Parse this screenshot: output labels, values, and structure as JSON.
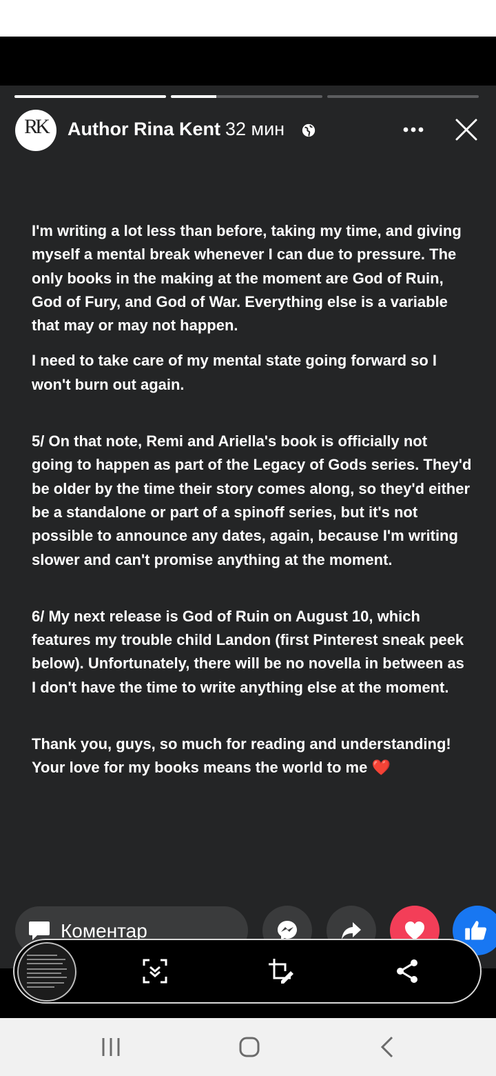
{
  "story": {
    "progress": [
      1.0,
      0.3,
      0.0
    ],
    "author_name": "Author Rina Kent",
    "avatar_monogram": "RK",
    "time": "32 мин",
    "privacy_icon": "globe-icon",
    "more_icon": "more-icon",
    "close_icon": "close-icon"
  },
  "post": {
    "paragraphs": [
      "I'm writing a lot less than before, taking my time, and giving myself a mental break whenever I can due to pressure. The only books in the making at the moment are God of Ruin, God of Fury, and God of War. Everything else is a variable that may or may not happen.",
      "I need to take care of my mental state going forward so I won't burn out again.",
      "5/ On that note, Remi and Ariella's book is officially not going to happen as part of the Legacy of Gods series. They'd be older by the time their story comes along, so they'd either be a standalone or part of a spinoff series, but it's not possible to announce any dates, again, because I'm writing slower and can't promise anything at the moment.",
      "6/ My next release is God of Ruin on August 10, which features my trouble child Landon (first Pinterest sneak peek below). Unfortunately, there will be no novella in between as I don't have the time to write anything else at the moment.",
      "Thank you, guys, so much for reading and understanding! Your love for my books means the world to me",
      "❤️"
    ]
  },
  "actions": {
    "comment_label": "Коментар",
    "icons": [
      "comment-icon",
      "messenger-icon",
      "share-arrow-icon",
      "love-reaction-icon",
      "like-reaction-icon"
    ]
  },
  "screenshot_toolbar": {
    "icons": [
      "scroll-capture-icon",
      "crop-edit-icon",
      "share-icon"
    ]
  },
  "system_nav": {
    "icons": [
      "recents-icon",
      "home-icon",
      "back-icon"
    ]
  },
  "colors": {
    "panel": "#242526",
    "love": "#f33e58",
    "like": "#1877f2"
  }
}
